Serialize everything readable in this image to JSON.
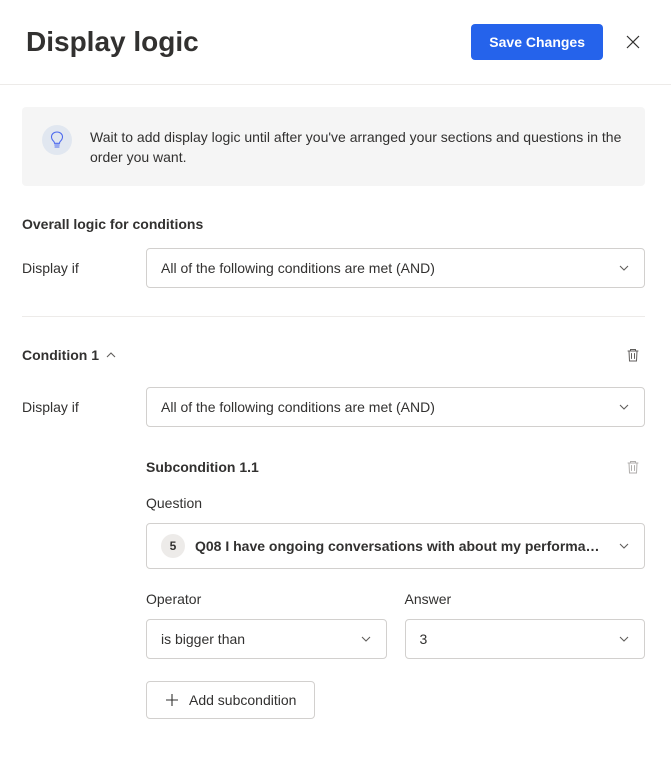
{
  "header": {
    "title": "Display logic",
    "save_label": "Save Changes"
  },
  "banner": {
    "text": "Wait to add display logic until after you've arranged your sections and questions in the order you want."
  },
  "overall": {
    "section_label": "Overall logic for conditions",
    "display_if_label": "Display if",
    "logic_value": "All of the following conditions are met (AND)"
  },
  "condition1": {
    "title": "Condition 1",
    "display_if_label": "Display if",
    "logic_value": "All of the following conditions are met (AND)",
    "sub": {
      "title": "Subcondition 1.1",
      "question_label": "Question",
      "question_badge": "5",
      "question_text": "Q08 I have ongoing conversations with about my performan…",
      "operator_label": "Operator",
      "operator_value": "is bigger than",
      "answer_label": "Answer",
      "answer_value": "3"
    },
    "add_sub_label": "Add subcondition"
  }
}
